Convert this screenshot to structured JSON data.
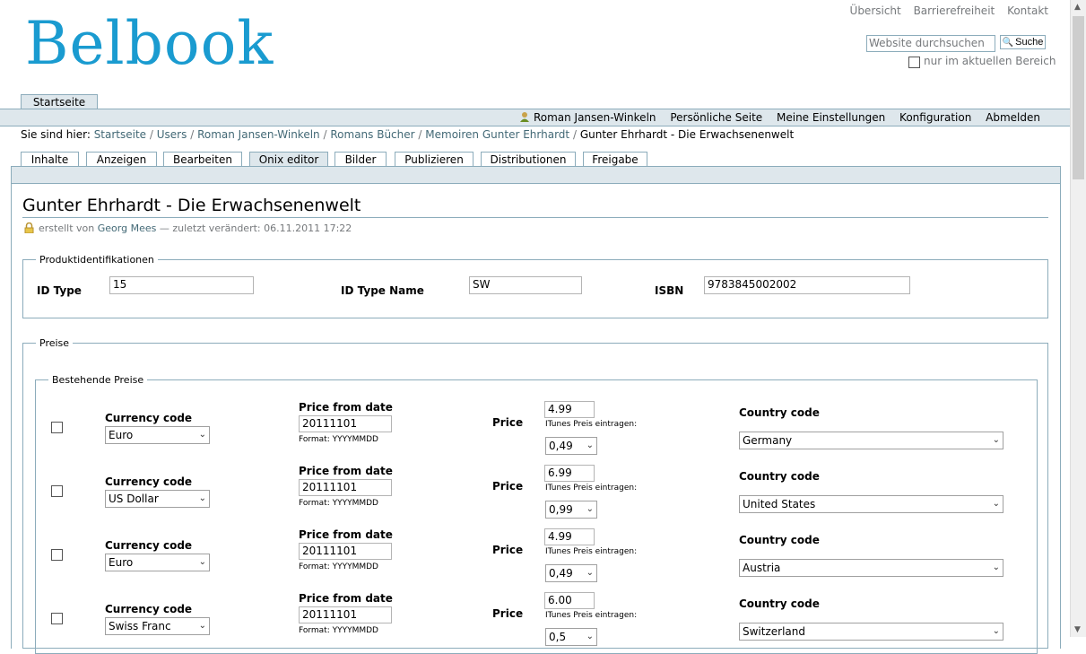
{
  "site_actions": [
    "Übersicht",
    "Barrierefreiheit",
    "Kontakt"
  ],
  "logo": "Belbook",
  "search": {
    "placeholder": "Website durchsuchen",
    "button": "Suche",
    "checkbox_label": "nur im aktuellen Bereich"
  },
  "global_tab": "Startseite",
  "personal": {
    "user": "Roman Jansen-Winkeln",
    "links": [
      "Persönliche Seite",
      "Meine Einstellungen",
      "Konfiguration",
      "Abmelden"
    ]
  },
  "breadcrumb": {
    "prefix": "Sie sind hier:",
    "items": [
      "Startseite",
      "Users",
      "Roman Jansen-Winkeln",
      "Romans Bücher",
      "Memoiren Gunter Ehrhardt"
    ],
    "current": "Gunter Ehrhardt - Die Erwachsenenwelt"
  },
  "content_tabs": [
    "Inhalte",
    "Anzeigen",
    "Bearbeiten",
    "Onix editor",
    "Bilder",
    "Publizieren",
    "Distributionen",
    "Freigabe"
  ],
  "doc": {
    "title": "Gunter Ehrhardt - Die Erwachsenenwelt",
    "byline_prefix": "erstellt von",
    "author": "Georg Mees",
    "byline_suffix": "— zuletzt verändert: 06.11.2011 17:22"
  },
  "product_id": {
    "legend": "Produktidentifikationen",
    "id_type_label": "ID Type",
    "id_type": "15",
    "id_type_name_label": "ID Type Name",
    "id_type_name": "SW",
    "isbn_label": "ISBN",
    "isbn": "9783845002002"
  },
  "prices": {
    "legend": "Preise",
    "existing_legend": "Bestehende Preise",
    "labels": {
      "currency": "Currency code",
      "date": "Price from date",
      "format": "Format: YYYYMMDD",
      "price": "Price",
      "itunes": "ITunes Preis eintragen:",
      "country": "Country code"
    },
    "rows": [
      {
        "currency": "Euro",
        "date": "20111101",
        "price": "4.99",
        "itunes": "0,49",
        "country": "Germany"
      },
      {
        "currency": "US Dollar",
        "date": "20111101",
        "price": "6.99",
        "itunes": "0,99",
        "country": "United States"
      },
      {
        "currency": "Euro",
        "date": "20111101",
        "price": "4.99",
        "itunes": "0,49",
        "country": "Austria"
      },
      {
        "currency": "Swiss Franc",
        "date": "20111101",
        "price": "6.00",
        "itunes": "0,5",
        "country": "Switzerland"
      }
    ]
  }
}
